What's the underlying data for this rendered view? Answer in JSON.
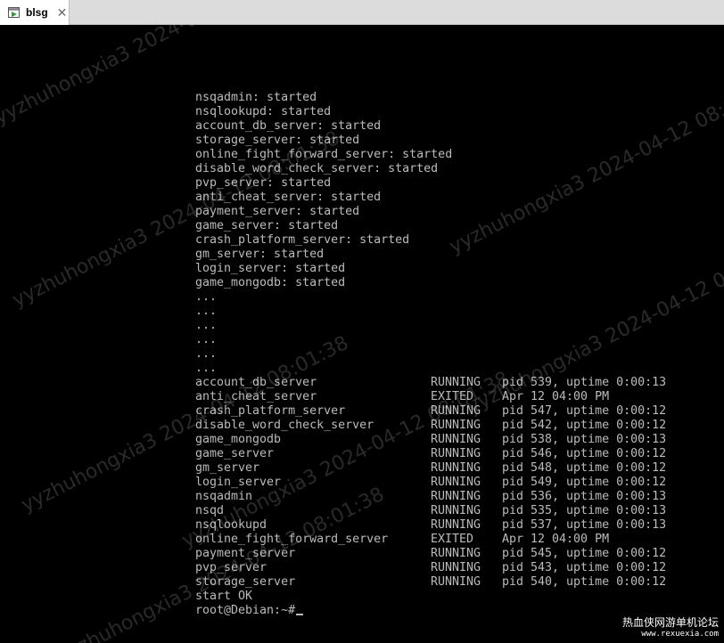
{
  "tab": {
    "label": "blsg",
    "close_glyph": "✕",
    "icon": "terminal-window-icon"
  },
  "terminal": {
    "start_lines": [
      "nsqadmin: started",
      "nsqlookupd: started",
      "account_db_server: started",
      "storage_server: started",
      "online_fight_forward_server: started",
      "disable_word_check_server: started",
      "pvp_server: started",
      "anti_cheat_server: started",
      "payment_server: started",
      "game_server: started",
      "crash_platform_server: started",
      "gm_server: started",
      "login_server: started",
      "game_mongodb: started"
    ],
    "ellipsis_lines": [
      "...",
      "...",
      "...",
      "...",
      "...",
      "..."
    ],
    "status_rows": [
      {
        "name": "account_db_server",
        "state": "RUNNING",
        "info": "pid 539, uptime 0:00:13"
      },
      {
        "name": "anti_cheat_server",
        "state": "EXITED",
        "info": "Apr 12 04:00 PM"
      },
      {
        "name": "crash_platform_server",
        "state": "RUNNING",
        "info": "pid 547, uptime 0:00:12"
      },
      {
        "name": "disable_word_check_server",
        "state": "RUNNING",
        "info": "pid 542, uptime 0:00:12"
      },
      {
        "name": "game_mongodb",
        "state": "RUNNING",
        "info": "pid 538, uptime 0:00:13"
      },
      {
        "name": "game_server",
        "state": "RUNNING",
        "info": "pid 546, uptime 0:00:12"
      },
      {
        "name": "gm_server",
        "state": "RUNNING",
        "info": "pid 548, uptime 0:00:12"
      },
      {
        "name": "login_server",
        "state": "RUNNING",
        "info": "pid 549, uptime 0:00:12"
      },
      {
        "name": "nsqadmin",
        "state": "RUNNING",
        "info": "pid 536, uptime 0:00:13"
      },
      {
        "name": "nsqd",
        "state": "RUNNING",
        "info": "pid 535, uptime 0:00:13"
      },
      {
        "name": "nsqlookupd",
        "state": "RUNNING",
        "info": "pid 537, uptime 0:00:13"
      },
      {
        "name": "online_fight_forward_server",
        "state": "EXITED",
        "info": "Apr 12 04:00 PM"
      },
      {
        "name": "payment_server",
        "state": "RUNNING",
        "info": "pid 545, uptime 0:00:12"
      },
      {
        "name": "pvp_server",
        "state": "RUNNING",
        "info": "pid 543, uptime 0:00:12"
      },
      {
        "name": "storage_server",
        "state": "RUNNING",
        "info": "pid 540, uptime 0:00:12"
      }
    ],
    "result_line": "start OK",
    "prompt": "root@Debian:~#",
    "text_color": "#bbbbbb",
    "background_color": "#000000"
  },
  "watermarks": [
    "yyzhuhongxia3 2024-04-12 08:01:38",
    "yyzhuhongxia3 2024-04-12 08:01:38",
    "yyzhuhongxia3 2024-04-12 08:01:38",
    "yyzhuhongxia3 2024-04-12 08:01:38",
    "yyzhuhongxia3 2024-04-12 08:01:38",
    "yyzhuhongxia3 2024-04-12 08:01:38",
    "yyzhuhongxia3 2024-04-12 08:01:38"
  ],
  "site_logo": {
    "name": "热血侠网游单机论坛",
    "url": "www.rexuexia.com"
  }
}
